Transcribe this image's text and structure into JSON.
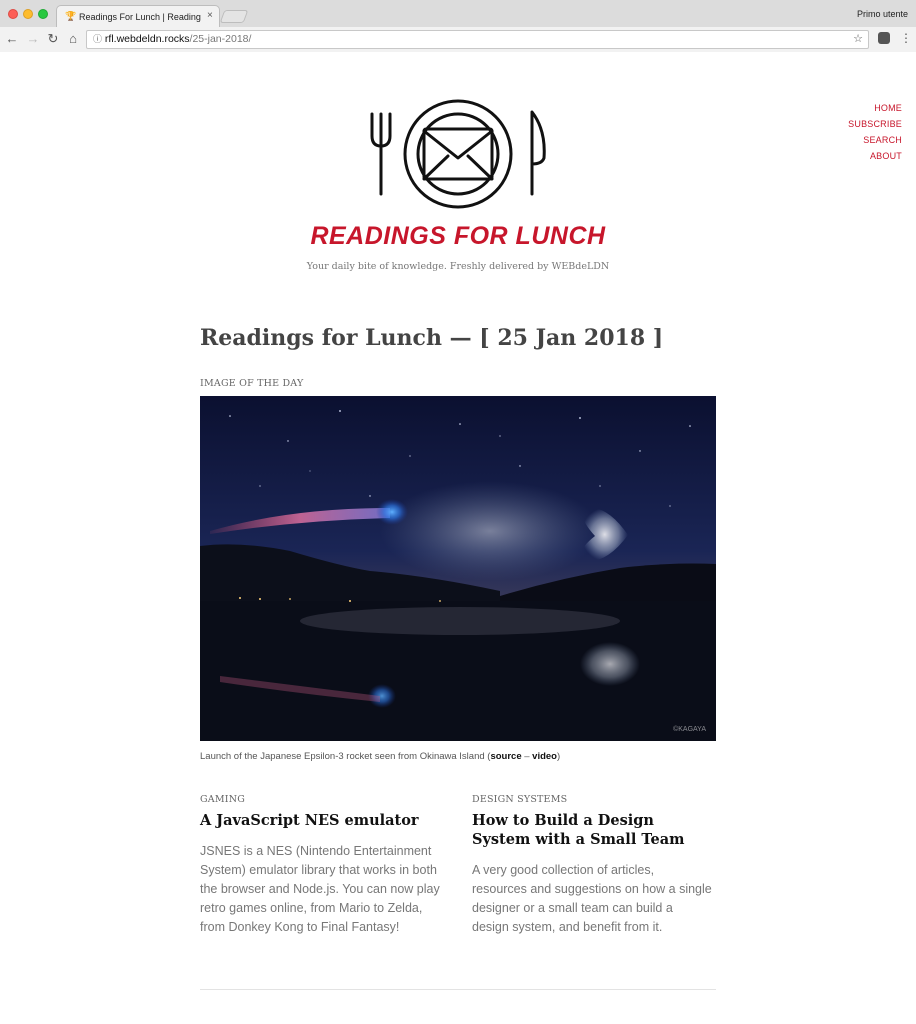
{
  "browser": {
    "tab_title": "Readings For Lunch | Readings",
    "tab_close": "×",
    "user": "Primo utente",
    "url_host": "rfl.webdeldn.rocks",
    "url_path": "/25-jan-2018/"
  },
  "nav": {
    "items": [
      "HOME",
      "SUBSCRIBE",
      "SEARCH",
      "ABOUT"
    ]
  },
  "header": {
    "title": "READINGS FOR LUNCH",
    "tagline": "Your daily bite of knowledge. Freshly delivered by WEBdeLDN"
  },
  "post": {
    "title": "Readings for Lunch — [ 25 Jan 2018 ]",
    "image_section_label": "IMAGE OF THE DAY",
    "image_credit": "©KAGAYA",
    "caption_text": "Launch of the Japanese Epsilon-3 rocket seen from Okinawa Island (",
    "caption_link1": "source",
    "caption_sep": " – ",
    "caption_link2": "video",
    "caption_end": ")"
  },
  "articles": [
    {
      "category": "GAMING",
      "title": "A JavaScript NES emulator",
      "text": "JSNES is a NES (Nintendo Entertainment System) emulator library that works in both the browser and Node.js. You can now play retro games online, from Mario to Zelda, from Donkey Kong to Final Fantasy!"
    },
    {
      "category": "DESIGN SYSTEMS",
      "title": "How to Build a Design System with a Small Team",
      "text": "A very good collection of articles, resources and suggestions on how a single designer or a small team can build a design system, and benefit from it."
    }
  ],
  "colors": {
    "accent": "#c7162b"
  }
}
